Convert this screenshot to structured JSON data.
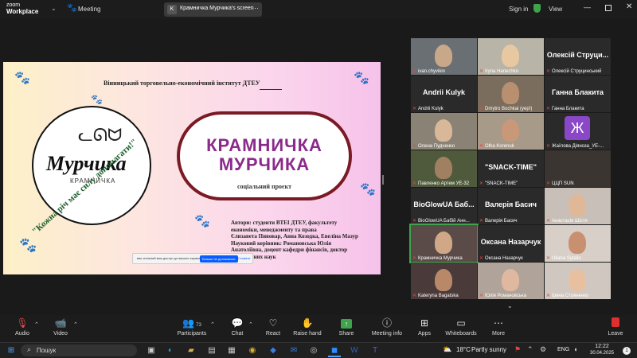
{
  "app": {
    "brand_line1": "zoom",
    "brand_line2": "Workplace",
    "meeting_label": "Meeting"
  },
  "share_tab": {
    "badge": "K",
    "title": "Крамничка Мурчика's screen"
  },
  "topbar_right": {
    "sign_in": "Sign in",
    "view": "View"
  },
  "slide": {
    "institute": "Вінницький торговельно-економічний інститут ДТЕУ",
    "logo_name": "Мурчика",
    "logo_sub": "КРАМНИЧКА",
    "logo_motto": "\"Кожна річ має силу допомагати!\"",
    "title_line1": "КРАМНИЧКА",
    "title_line2": "МУРЧИКА",
    "subtitle": "соціальний проєкт",
    "authors_lines": [
      "Автори: студенти ВТЕІ ДТЕУ, факультету",
      "економіки, менеджменту та права",
      "Єлизавета Пивовар, Анна Козодка, Евеліна Мазур",
      "Науковий керівник: Романовська Юлія",
      "Анатоліївна, доцент кафедри фінансів, доктор",
      "економічних наук"
    ],
    "banner_text": "вас спільний має доступ до вашого екрана",
    "banner_primary": "Більше не допомагати",
    "banner_secondary": "Сховати"
  },
  "participants": [
    {
      "name": "ivan.chyvikin",
      "big": ""
    },
    {
      "name": "Iryna Hanechko",
      "big": ""
    },
    {
      "name": "Олексій Струцинський",
      "big": "Олексій Струци..."
    },
    {
      "name": "Andrii Kulyk",
      "big": "Andrii Kulyk"
    },
    {
      "name": "Dmytro Bochkai (yep!)",
      "big": ""
    },
    {
      "name": "Ганна Блакита",
      "big": "Ганна Блакита"
    },
    {
      "name": "Олена Пудченко",
      "big": ""
    },
    {
      "name": "Olha Korenuk",
      "big": ""
    },
    {
      "name": "Жаїлова Діяноза_УЕ-...",
      "big": ""
    },
    {
      "name": "Павленко Артем УЕ-32",
      "big": ""
    },
    {
      "name": "\"SNACK-TIME\"",
      "big": "\"SNACK-TIME\""
    },
    {
      "name": "ЦЦП SUN",
      "big": ""
    },
    {
      "name": "BioGlowUA Бабій Анн...",
      "big": "BioGlowUA Баб..."
    },
    {
      "name": "Валерія Басич",
      "big": "Валерія Басич"
    },
    {
      "name": "Анастасія Шістя",
      "big": ""
    },
    {
      "name": "Крамничка Мурчика",
      "big": ""
    },
    {
      "name": "Оксана Назарчук",
      "big": "Оксана Назарчук"
    },
    {
      "name": "Uliana Sytailo",
      "big": ""
    },
    {
      "name": "Kateryna Bagatska",
      "big": ""
    },
    {
      "name": "Юлія Романовська",
      "big": ""
    },
    {
      "name": "Ірина Стояненко",
      "big": ""
    }
  ],
  "toolbar": {
    "audio": "Audio",
    "video": "Video",
    "participants": "Participants",
    "participants_count": "73",
    "chat": "Chat",
    "react": "React",
    "raise_hand": "Raise hand",
    "share": "Share",
    "meeting_info": "Meeting info",
    "apps": "Apps",
    "whiteboards": "Whiteboards",
    "more": "More",
    "leave": "Leave"
  },
  "taskbar": {
    "search": "Пошук",
    "weather_temp": "18°C",
    "weather_text": "Partly sunny",
    "lang": "ENG",
    "time": "12:22",
    "date": "30.04.2025",
    "notif_count": "1"
  },
  "colors": {
    "accent_green": "#3fa34d",
    "zoom_blue": "#0b5cff",
    "leave_red": "#e02f2f",
    "slide_title": "#7a1f7a"
  }
}
